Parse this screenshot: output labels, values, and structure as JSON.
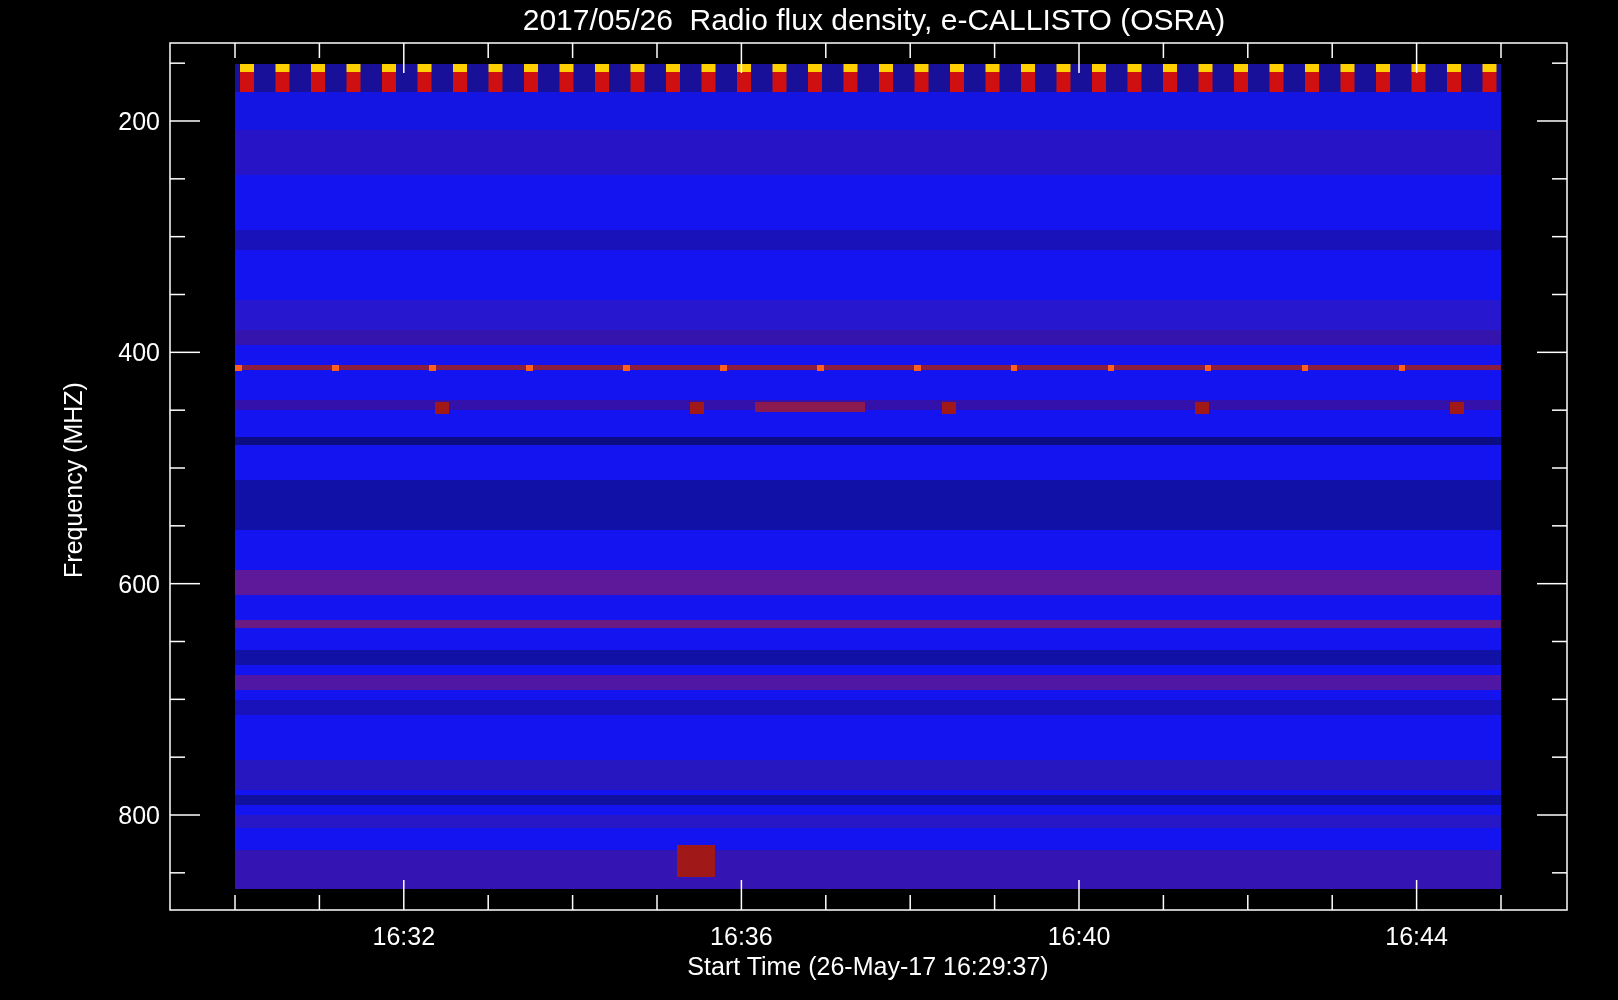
{
  "title": "2017/05/26  Radio flux density, e-CALLISTO (OSRA)",
  "y_axis": {
    "label": "Frequency (MHZ)",
    "ticks": [
      "200",
      "400",
      "600",
      "800"
    ]
  },
  "x_axis": {
    "label": "Start Time (26-May-17 16:29:37)",
    "ticks": [
      "16:32",
      "16:36",
      "16:40",
      "16:44"
    ]
  }
}
